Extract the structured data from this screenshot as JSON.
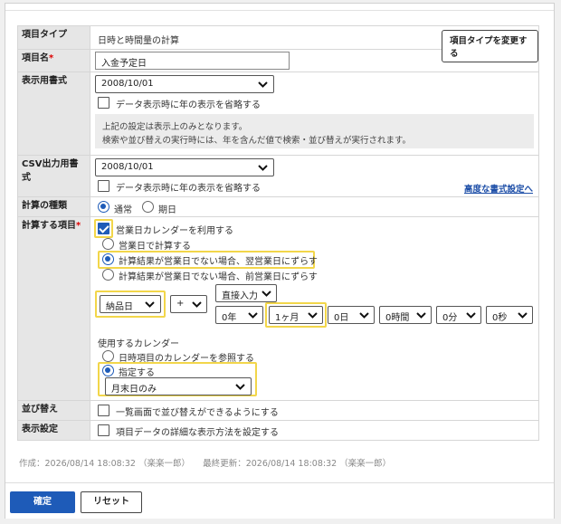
{
  "form": {
    "item_type": {
      "label": "項目タイプ",
      "value": "日時と時間量の計算",
      "change_button": "項目タイプを変更する"
    },
    "item_name": {
      "label": "項目名",
      "required": "*",
      "value": "入金予定日"
    },
    "display_format": {
      "label": "表示用書式",
      "select": "2008/10/01",
      "omit_year_checkbox": "データ表示時に年の表示を省略する",
      "note_line1": "上記の設定は表示上のみとなります。",
      "note_line2": "検索や並び替えの実行時には、年を含んだ値で検索・並び替えが実行されます。"
    },
    "csv_format": {
      "label": "CSV出力用書式",
      "select": "2008/10/01",
      "omit_year_checkbox": "データ表示時に年の表示を省略する",
      "advanced_link": "高度な書式設定へ"
    },
    "calc_kind": {
      "label": "計算の種類",
      "option_normal": "通常",
      "option_period": "期日"
    },
    "calc_item": {
      "label": "計算する項目",
      "required": "*",
      "use_business_calendar": "営業日カレンダーを利用する",
      "opt_business_day": "営業日で計算する",
      "opt_next_business_day": "計算結果が営業日でない場合、翌営業日にずらす",
      "opt_prev_business_day": "計算結果が営業日でない場合、前営業日にずらす",
      "field_select": "納品日",
      "operator_select": "+",
      "input_mode_select": "直接入力",
      "year_select": "0年",
      "month_select": "1ヶ月",
      "day_select": "0日",
      "hour_select": "0時間",
      "minute_select": "0分",
      "second_select": "0秒",
      "calendar_heading": "使用するカレンダー",
      "opt_ref_calendar": "日時項目のカレンダーを参照する",
      "opt_specify": "指定する",
      "calendar_select": "月末日のみ"
    },
    "sort": {
      "label": "並び替え",
      "checkbox": "一覧画面で並び替えができるようにする"
    },
    "display_setting": {
      "label": "表示設定",
      "checkbox": "項目データの詳細な表示方法を設定する"
    }
  },
  "meta": {
    "text": "作成：2026/08/14 18:08:32 （楽楽一郎）　　最終更新：2026/08/14 18:08:32 （楽楽一郎）"
  },
  "footer": {
    "confirm": "確定",
    "reset": "リセット"
  },
  "colors": {
    "accent": "#1e5bb8",
    "highlight": "#f2d64a",
    "label_bg": "#e6e6e6"
  }
}
